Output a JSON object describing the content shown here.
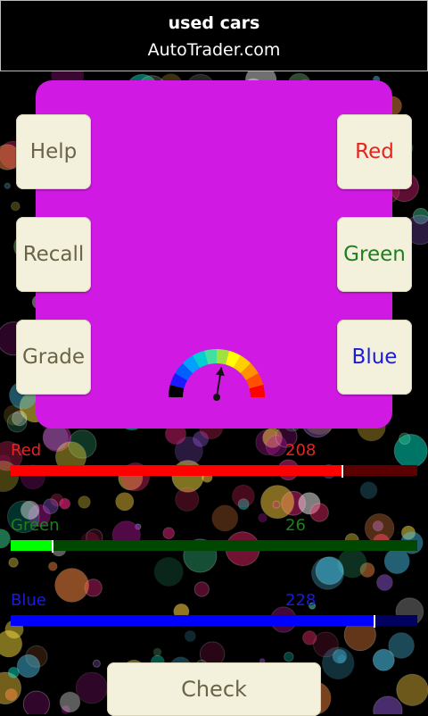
{
  "ad": {
    "title": "used cars",
    "subtitle": "AutoTrader.com"
  },
  "swatch": {
    "color": "#d01ae4"
  },
  "buttons": {
    "help": "Help",
    "recall": "Recall",
    "grade": "Grade",
    "red": "Red",
    "green": "Green",
    "blue": "Blue",
    "check": "Check"
  },
  "colors": {
    "red_text": "#e8231f",
    "green_text": "#1e7f1e",
    "blue_text": "#1a1ae0",
    "button_text": "#6b6448",
    "button_bg": "#f3f1dc"
  },
  "sliders": {
    "red": {
      "label": "Red",
      "value": "208",
      "fraction": 0.816
    },
    "green": {
      "label": "Green",
      "value": "26",
      "fraction": 0.102
    },
    "blue": {
      "label": "Blue",
      "value": "228",
      "fraction": 0.894
    }
  },
  "gauge": {
    "needle_level": 0.55
  }
}
